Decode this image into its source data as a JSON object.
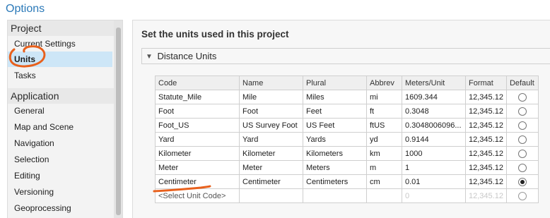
{
  "window": {
    "title": "Options"
  },
  "sidebar": {
    "sections": [
      {
        "header": "Project",
        "items": [
          "Current Settings",
          "Units",
          "Tasks"
        ]
      },
      {
        "header": "Application",
        "items": [
          "General",
          "Map and Scene",
          "Navigation",
          "Selection",
          "Editing",
          "Versioning",
          "Geoprocessing"
        ]
      }
    ],
    "selected": "Units"
  },
  "main": {
    "heading": "Set the units used in this project",
    "expander": {
      "label": "Distance Units",
      "expanded": true,
      "icon": "chevron-down-icon"
    },
    "table": {
      "columns": [
        "Code",
        "Name",
        "Plural",
        "Abbrev",
        "Meters/Unit",
        "Format",
        "Default"
      ],
      "rows": [
        {
          "code": "Statute_Mile",
          "name": "Mile",
          "plural": "Miles",
          "abbrev": "mi",
          "meters": "1609.344",
          "format": "12,345.12",
          "default": false
        },
        {
          "code": "Foot",
          "name": "Foot",
          "plural": "Feet",
          "abbrev": "ft",
          "meters": "0.3048",
          "format": "12,345.12",
          "default": false
        },
        {
          "code": "Foot_US",
          "name": "US Survey Foot",
          "plural": "US Feet",
          "abbrev": "ftUS",
          "meters": "0.3048006096...",
          "format": "12,345.12",
          "default": false
        },
        {
          "code": "Yard",
          "name": "Yard",
          "plural": "Yards",
          "abbrev": "yd",
          "meters": "0.9144",
          "format": "12,345.12",
          "default": false
        },
        {
          "code": "Kilometer",
          "name": "Kilometer",
          "plural": "Kilometers",
          "abbrev": "km",
          "meters": "1000",
          "format": "12,345.12",
          "default": false
        },
        {
          "code": "Meter",
          "name": "Meter",
          "plural": "Meters",
          "abbrev": "m",
          "meters": "1",
          "format": "12,345.12",
          "default": false
        },
        {
          "code": "Centimeter",
          "name": "Centimeter",
          "plural": "Centimeters",
          "abbrev": "cm",
          "meters": "0.01",
          "format": "12,345.12",
          "default": true
        }
      ],
      "new_row": {
        "placeholder": "<Select Unit Code>",
        "meters": "0",
        "format": "12,345.12"
      }
    }
  },
  "annotation_color": "#e8601c"
}
